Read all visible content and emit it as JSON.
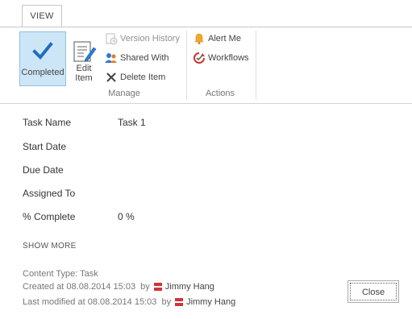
{
  "ribbon": {
    "tab_label": "VIEW",
    "completed_label": "Completed",
    "edit_label_1": "Edit",
    "edit_label_2": "Item",
    "version_history": "Version History",
    "shared_with": "Shared With",
    "delete_item": "Delete Item",
    "manage_group": "Manage",
    "alert_me": "Alert Me",
    "workflows": "Workflows",
    "actions_group": "Actions"
  },
  "fields": [
    {
      "label": "Task Name",
      "value": "Task 1"
    },
    {
      "label": "Start Date",
      "value": ""
    },
    {
      "label": "Due Date",
      "value": ""
    },
    {
      "label": "Assigned To",
      "value": ""
    },
    {
      "label": "% Complete",
      "value": "0 %"
    }
  ],
  "show_more": "SHOW MORE",
  "footer": {
    "content_type": "Content Type: Task",
    "created": "Created at 08.08.2014 15:03  by",
    "created_by": "Jimmy Hang",
    "modified": "Last modified at 08.08.2014 15:03  by",
    "modified_by": "Jimmy Hang",
    "close_label": "Close"
  },
  "colors": {
    "accent_blue": "#1f6ebf",
    "selected_bg": "#cde6f7",
    "presence_red": "#d13438"
  }
}
